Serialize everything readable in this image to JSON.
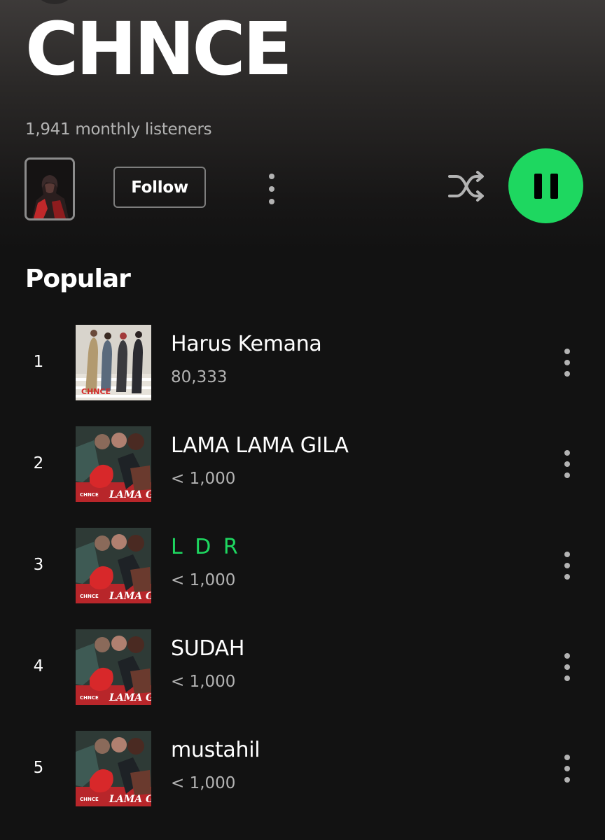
{
  "artist": {
    "name": "CHNCE",
    "monthly_listeners": "1,941 monthly listeners",
    "follow_label": "Follow"
  },
  "icons": {
    "shuffle": "shuffle-icon",
    "pause": "pause-icon",
    "more": "more-vertical-icon"
  },
  "colors": {
    "accent": "#1ed760",
    "background": "#121212",
    "secondary_text": "#b3b3b3"
  },
  "popular": {
    "title": "Popular",
    "tracks": [
      {
        "rank": "1",
        "title": "Harus Kemana",
        "plays": "80,333",
        "cover_text": "CHNCE",
        "playing": false
      },
      {
        "rank": "2",
        "title": "LAMA LAMA GILA",
        "plays": "< 1,000",
        "cover_text": "LAMA Gila",
        "playing": false
      },
      {
        "rank": "3",
        "title": "L D R",
        "plays": "< 1,000",
        "cover_text": "LAMA Gila",
        "playing": true
      },
      {
        "rank": "4",
        "title": "SUDAH",
        "plays": "< 1,000",
        "cover_text": "LAMA Gila",
        "playing": false
      },
      {
        "rank": "5",
        "title": "mustahil",
        "plays": "< 1,000",
        "cover_text": "LAMA Gila",
        "playing": false
      }
    ]
  }
}
